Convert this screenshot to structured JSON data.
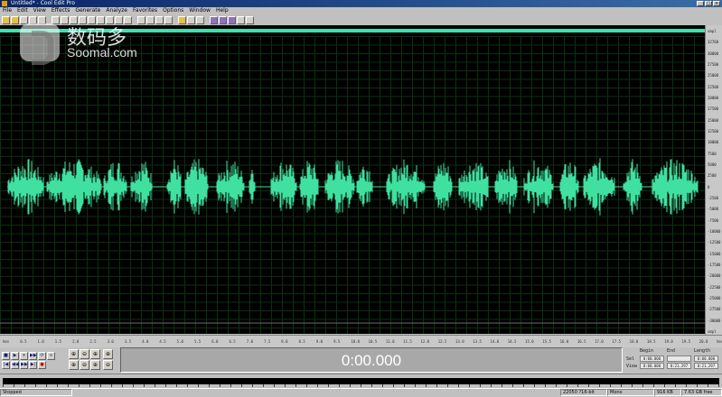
{
  "window": {
    "title": "Untitled* - Cool Edit Pro",
    "controls": [
      "_",
      "□",
      "×"
    ]
  },
  "menu": [
    "File",
    "Edit",
    "View",
    "Effects",
    "Generate",
    "Analyze",
    "Favorites",
    "Options",
    "Window",
    "Help"
  ],
  "toolbar_icons": [
    "new-icon",
    "open-icon",
    "save-icon",
    "save-all-icon",
    "close-icon",
    "multitrack-icon",
    "cut-icon",
    "copy-icon",
    "paste-icon",
    "paste-new-icon",
    "mix-paste-icon",
    "trim-icon",
    "undo-icon",
    "redo-icon",
    "repeat-icon",
    "spectral-icon",
    "waveform-icon",
    "snap-icon",
    "cue-icon",
    "play-icon",
    "settings-icon",
    "zoom-icon",
    "info-icon",
    "scripts-icon",
    "favorites-icon",
    "help-icon"
  ],
  "watermark": {
    "cn": "数码多",
    "en": "Soomal.com"
  },
  "right_ruler": [
    "smpl",
    "32768",
    "30000",
    "27500",
    "25000",
    "22500",
    "20000",
    "17500",
    "15000",
    "12500",
    "10000",
    "7500",
    "5000",
    "2500",
    "0",
    "-2500",
    "-5000",
    "-7500",
    "-10000",
    "-12500",
    "-15000",
    "-17500",
    "-20000",
    "-22500",
    "-25000",
    "-27500",
    "-30000",
    "smpl"
  ],
  "time_ruler": [
    "hms",
    "0.5",
    "1.0",
    "1.5",
    "2.0",
    "2.5",
    "3.0",
    "3.5",
    "4.0",
    "4.5",
    "5.0",
    "5.5",
    "6.0",
    "6.5",
    "7.0",
    "7.5",
    "8.0",
    "8.5",
    "9.0",
    "9.5",
    "10.0",
    "10.5",
    "11.0",
    "11.5",
    "12.0",
    "12.5",
    "13.0",
    "13.5",
    "14.0",
    "14.5",
    "15.0",
    "15.5",
    "16.0",
    "16.5",
    "17.0",
    "17.5",
    "18.0",
    "18.5",
    "19.0",
    "19.5",
    "20.0",
    "hms"
  ],
  "transport": {
    "row1": [
      "■",
      "▶",
      "⏸",
      "▶▶",
      "⟳",
      "∞"
    ],
    "row2": [
      "|◀",
      "◀◀",
      "▶▶",
      "▶|",
      "●",
      ""
    ]
  },
  "zoom": [
    "⊕",
    "⊖",
    "⊕",
    "⊕",
    "⊖",
    "⊕"
  ],
  "time_display": "0:00.000",
  "selection": {
    "headers": [
      "Begin",
      "End",
      "Length"
    ],
    "rows": [
      {
        "label": "Sel",
        "begin": "0:00.000",
        "end": "",
        "length": "0:00.000"
      },
      {
        "label": "View",
        "begin": "0:00.000",
        "end": "0:21.297",
        "length": "0:21.297"
      }
    ]
  },
  "status": {
    "state": "Stopped",
    "format": "22050 ?16-bit",
    "mono": "Mono",
    "size": "916 KB",
    "free": "7.63 GB free"
  },
  "colors": {
    "waveform": "#40e0a0",
    "background": "#000000",
    "grid": "#0d3010",
    "overview": "#40e0b0"
  }
}
